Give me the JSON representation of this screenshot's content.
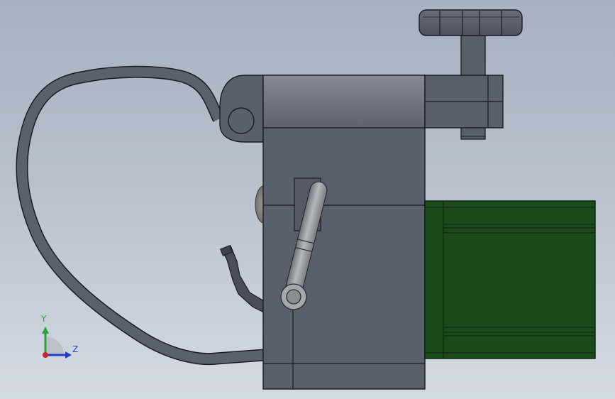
{
  "viewport": {
    "background_top": "#a7b1c1",
    "background_bottom": "#d5dae2"
  },
  "colors": {
    "body_gray": "#5a5f6c",
    "body_top": "#7d8190",
    "edge": "#1b1c22",
    "motor_green": "#1b4a1b",
    "motor_edge": "#0c200c",
    "handle_light": "#a9acb1",
    "handle_dark": "#6e7176",
    "axis_y": "#2aa33a",
    "axis_z": "#1f3fc8",
    "axis_x": "#d0212a"
  },
  "icons": {
    "triad": "coordinate-triad-icon"
  },
  "triad": {
    "y_label": "Y",
    "z_label": "Z"
  }
}
